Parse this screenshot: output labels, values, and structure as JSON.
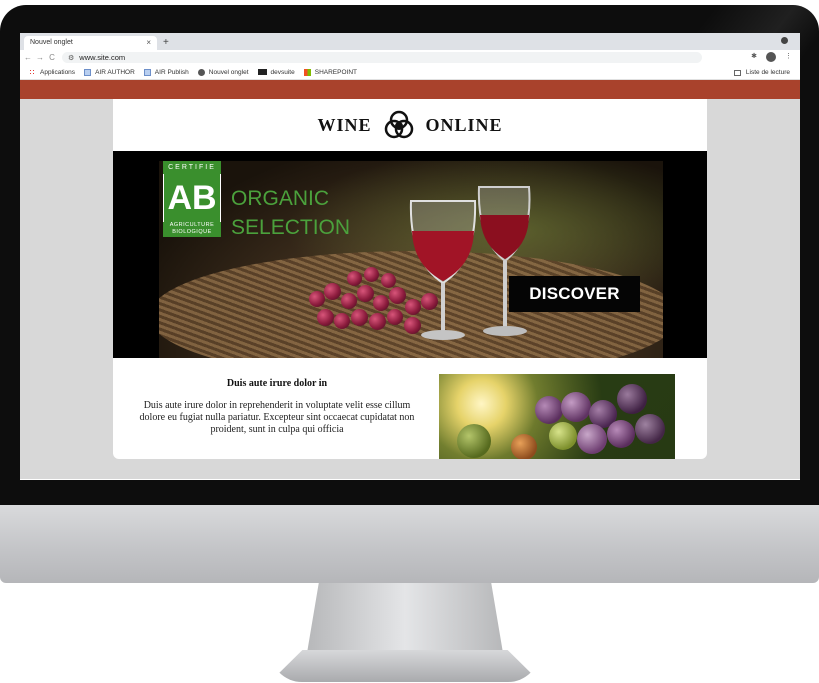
{
  "browser": {
    "tab_title": "Nouvel onglet",
    "tab_close": "×",
    "new_tab": "+",
    "back": "←",
    "forward": "→",
    "reload": "C",
    "url": "www.site.com",
    "bookmarks": [
      {
        "label": "Applications",
        "icon": "apps-icon"
      },
      {
        "label": "AIR AUTHOR",
        "icon": "doc-icon"
      },
      {
        "label": "AIR Publish",
        "icon": "doc-icon"
      },
      {
        "label": "Nouvel onglet",
        "icon": "globe-icon"
      },
      {
        "label": "devsuite",
        "icon": "devsuite-icon"
      },
      {
        "label": "SHAREPOINT",
        "icon": "sharepoint-icon"
      }
    ],
    "reading_list": "Liste de lecture"
  },
  "site": {
    "logo_left": "WINE",
    "logo_right": "ONLINE",
    "banner": {
      "badge_top": "CERTIFIE",
      "badge_mid": "AB",
      "badge_bottom_1": "AGRICULTURE",
      "badge_bottom_2": "BIOLOGIQUE",
      "headline_1": "ORGANIC",
      "headline_2": "SELECTION",
      "cta": "DISCOVER"
    },
    "article": {
      "title": "Duis aute irure dolor in",
      "body": "Duis aute irure dolor in reprehenderit in voluptate velit esse cillum dolore eu fugiat nulla pariatur. Excepteur sint occaecat cupidatat non proident, sunt in culpa qui officia"
    }
  },
  "colors": {
    "brand_red": "#a9422c",
    "organic_green": "#4ba13c",
    "badge_green": "#3a8f2d"
  }
}
